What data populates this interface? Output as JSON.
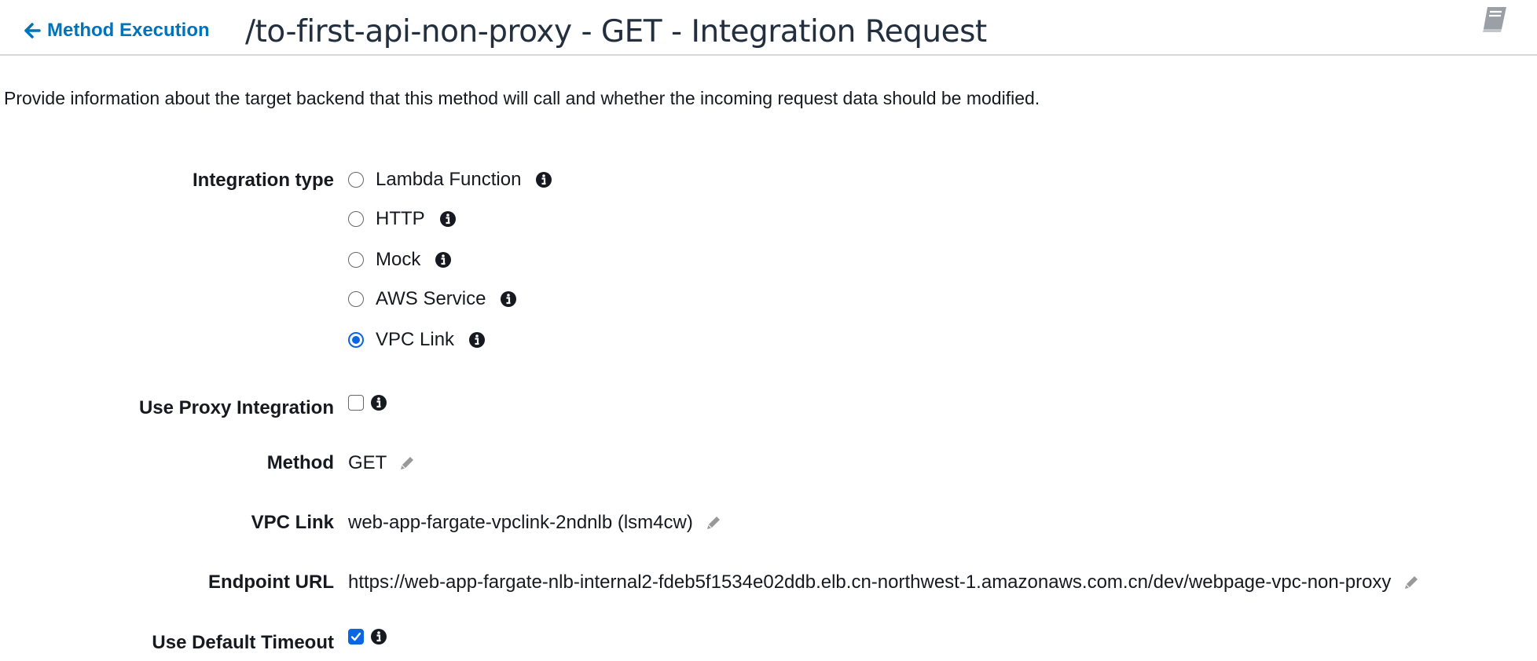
{
  "header": {
    "back_link": "Method Execution",
    "title": "/to-first-api-non-proxy - GET - Integration Request"
  },
  "description": "Provide information about the target backend that this method will call and whether the incoming request data should be modified.",
  "integration_type": {
    "label": "Integration type",
    "options": [
      {
        "label": "Lambda Function",
        "selected": false
      },
      {
        "label": "HTTP",
        "selected": false
      },
      {
        "label": "Mock",
        "selected": false
      },
      {
        "label": "AWS Service",
        "selected": false
      },
      {
        "label": "VPC Link",
        "selected": true
      }
    ]
  },
  "use_proxy_integration": {
    "label": "Use Proxy Integration",
    "checked": false
  },
  "method": {
    "label": "Method",
    "value": "GET"
  },
  "vpc_link": {
    "label": "VPC Link",
    "value": "web-app-fargate-vpclink-2ndnlb (lsm4cw)"
  },
  "endpoint_url": {
    "label": "Endpoint URL",
    "value": "https://web-app-fargate-nlb-internal2-fdeb5f1534e02ddb.elb.cn-northwest-1.amazonaws.com.cn/dev/webpage-vpc-non-proxy"
  },
  "use_default_timeout": {
    "label": "Use Default Timeout",
    "checked": true
  },
  "colors": {
    "link": "#0073bb",
    "selected": "#0a66e4",
    "icon": "#16191f",
    "pencil": "#999999"
  },
  "icons": {
    "back": "arrow-left-icon",
    "docs": "book-icon",
    "info": "info-icon",
    "edit": "pencil-icon"
  }
}
